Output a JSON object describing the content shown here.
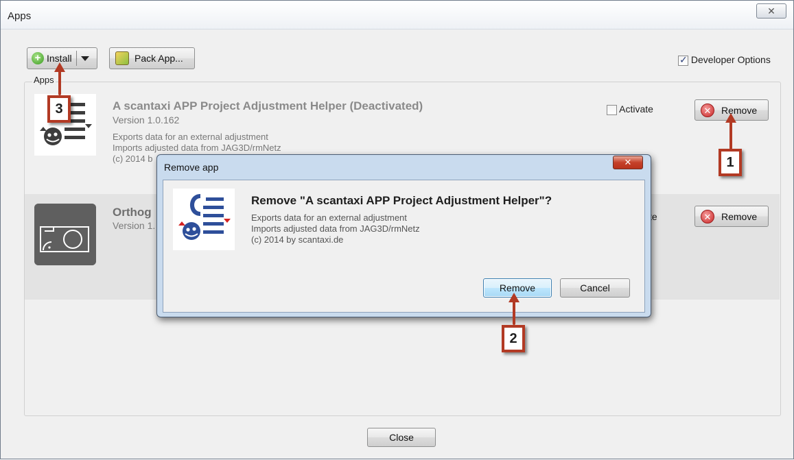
{
  "window": {
    "title": "Apps",
    "close_glyph": "✕"
  },
  "toolbar": {
    "install_label": "Install",
    "pack_label": "Pack App...",
    "developer_options_label": "Developer Options",
    "developer_options_checked": true
  },
  "apps_group": {
    "label": "Apps",
    "items": [
      {
        "name": "A scantaxi APP Project Adjustment Helper (Deactivated)",
        "version": "Version 1.0.162",
        "desc1": "Exports data for an external adjustment",
        "desc2": "Imports adjusted data from JAG3D/rmNetz",
        "desc3": "(c) 2014 b",
        "activate_label": "Activate",
        "remove_label": "Remove"
      },
      {
        "name": "Orthog",
        "version": "Version 1.",
        "activate_label": "te",
        "remove_label": "Remove"
      }
    ]
  },
  "dialog": {
    "title": "Remove app",
    "heading": "Remove \"A scantaxi APP Project Adjustment Helper\"?",
    "desc1": "Exports data for an external adjustment",
    "desc2": "Imports adjusted data from JAG3D/rmNetz",
    "desc3": "(c) 2014 by scantaxi.de",
    "remove_label": "Remove",
    "cancel_label": "Cancel"
  },
  "annotations": {
    "step1": "1",
    "step2": "2",
    "step3": "3"
  },
  "footer": {
    "close_label": "Close"
  },
  "colors": {
    "annotation": "#b23a24",
    "dialog_frame": "#c9dbee",
    "remove_icon": "#c92727"
  }
}
